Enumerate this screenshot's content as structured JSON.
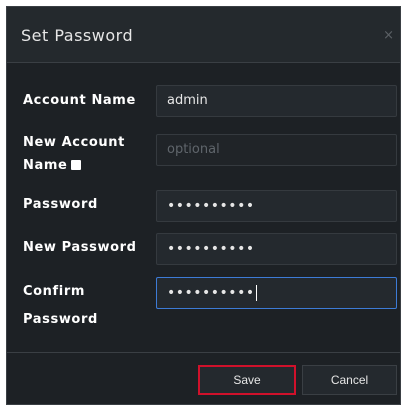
{
  "dialog": {
    "title": "Set Password",
    "close_glyph": "×"
  },
  "form": {
    "account_name": {
      "label": "Account Name",
      "value": "admin"
    },
    "new_account_name": {
      "label_line1": "New Account",
      "label_line2": "Name",
      "placeholder": "optional",
      "checkbox_checked": false
    },
    "password": {
      "label": "Password",
      "value": "••••••••••"
    },
    "new_password": {
      "label": "New Password",
      "value": "••••••••••"
    },
    "confirm_password": {
      "label_line1": "Confirm",
      "label_line2": "Password",
      "value": "••••••••••"
    }
  },
  "footer": {
    "save_label": "Save",
    "cancel_label": "Cancel"
  },
  "colors": {
    "dialog_bg": "#1d2125",
    "field_bg": "#24292e",
    "focus_border": "#3d7bd6",
    "save_highlight": "#d0112b"
  }
}
